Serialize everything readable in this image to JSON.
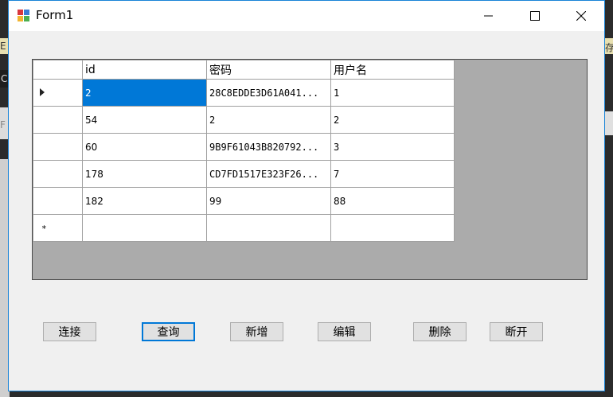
{
  "background": {
    "left_glyph_1": "E I",
    "left_glyph_2": "C",
    "left_glyph_3": "F",
    "right_glyph_1": "存"
  },
  "window": {
    "title": "Form1",
    "accent": "#0078d7",
    "controls": {
      "minimize": "minimize-icon",
      "maximize": "maximize-icon",
      "close": "close-icon"
    }
  },
  "grid": {
    "columns": [
      "id",
      "密码",
      "用户名"
    ],
    "rows": [
      {
        "id": "2",
        "password": "28C8EDDE3D61A041...",
        "username": "1",
        "selected": true
      },
      {
        "id": "54",
        "password": "2",
        "username": "2"
      },
      {
        "id": "60",
        "password": "9B9F61043B820792...",
        "username": "3"
      },
      {
        "id": "178",
        "password": "CD7FD1517E323F26...",
        "username": "7"
      },
      {
        "id": "182",
        "password": "99",
        "username": "88"
      }
    ],
    "new_row_marker": "*"
  },
  "buttons": {
    "connect": "连接",
    "query": "查询",
    "add": "新增",
    "edit": "编辑",
    "delete": "删除",
    "disconnect": "断开"
  }
}
